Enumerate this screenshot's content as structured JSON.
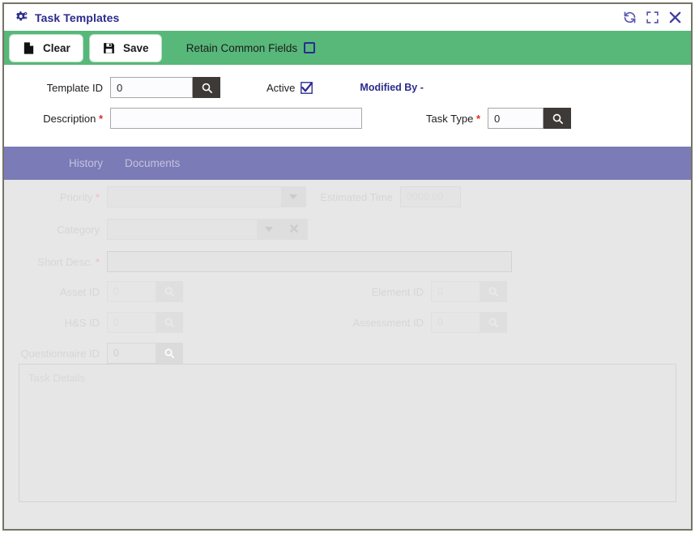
{
  "window": {
    "title": "Task Templates",
    "title_icon": "gear-icon",
    "controls": [
      {
        "name": "refresh-icon",
        "label": "Refresh"
      },
      {
        "name": "maximize-icon",
        "label": "Maximize"
      },
      {
        "name": "close-icon",
        "label": "Close"
      }
    ],
    "colors": {
      "toolbar_green": "#57b879",
      "tabbar_purple": "#7b7bb8",
      "title_text": "#2b2b8c",
      "lookup_button": "#3e3a38",
      "body_gray": "#e7e7e7",
      "border": "#767566",
      "required_asterisk": "#e02b2b"
    }
  },
  "toolbar": {
    "clear_label": "Clear",
    "clear_icon": "page-icon",
    "save_label": "Save",
    "save_icon": "floppy-disk-icon",
    "retain_label": "Retain Common Fields",
    "retain_checked": false
  },
  "form": {
    "template_id": {
      "label": "Template ID",
      "value": "0",
      "lookup_icon": "magnifier-icon"
    },
    "active": {
      "label": "Active",
      "checked": true
    },
    "modified_by": "Modified By -",
    "description": {
      "label": "Description",
      "required": true,
      "value": ""
    },
    "task_type": {
      "label": "Task Type",
      "required": true,
      "value": "0",
      "lookup_icon": "magnifier-icon"
    }
  },
  "tabs": [
    {
      "label": "History",
      "selected": false
    },
    {
      "label": "Documents",
      "selected": false
    }
  ],
  "disabled_section": {
    "priority": {
      "label": "Priority",
      "required": true,
      "value": ""
    },
    "estimated_time": {
      "label": "Estimated Time",
      "value": "0000:00"
    },
    "category": {
      "label": "Category",
      "value": ""
    },
    "short_desc": {
      "label": "Short Desc.",
      "required": true,
      "value": ""
    },
    "asset_id": {
      "label": "Asset ID",
      "value": "0"
    },
    "element_id": {
      "label": "Element ID",
      "value": "0"
    },
    "hs_id": {
      "label": "H&S ID",
      "value": "0"
    },
    "assessment_id": {
      "label": "Assessment ID",
      "value": "0"
    },
    "questionnaire_id": {
      "label": "Questionnaire ID",
      "value": "0"
    },
    "task_details": {
      "placeholder": "Task Details",
      "value": ""
    }
  }
}
